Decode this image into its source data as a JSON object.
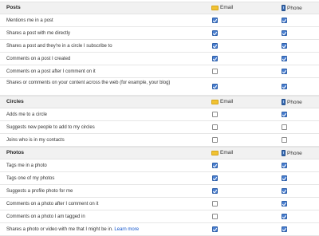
{
  "columns": {
    "email": "Email",
    "phone": "Phone"
  },
  "sections": [
    {
      "title": "Posts",
      "rows": [
        {
          "label": "Mentions me in a post",
          "email": true,
          "phone": true
        },
        {
          "label": "Shares a post with me directly",
          "email": true,
          "phone": true
        },
        {
          "label": "Shares a post and they're in a circle I subscribe to",
          "email": true,
          "phone": true
        },
        {
          "label": "Comments on a post I created",
          "email": true,
          "phone": true
        },
        {
          "label": "Comments on a post after I comment on it",
          "email": false,
          "phone": true
        },
        {
          "label": "Shares or comments on your content across the web (for example, your blog)",
          "email": true,
          "phone": true
        }
      ]
    },
    {
      "title": "Circles",
      "rows": [
        {
          "label": "Adds me to a circle",
          "email": false,
          "phone": true
        },
        {
          "label": "Suggests new people to add to my circles",
          "email": false,
          "phone": false
        },
        {
          "label": "Joins who is in my contacts",
          "email": false,
          "phone": false
        }
      ]
    },
    {
      "title": "Photos",
      "rows": [
        {
          "label": "Tags me in a photo",
          "email": true,
          "phone": true
        },
        {
          "label": "Tags one of my photos",
          "email": true,
          "phone": true
        },
        {
          "label": "Suggests a profile photo for me",
          "email": true,
          "phone": true
        },
        {
          "label": "Comments on a photo after I comment on it",
          "email": false,
          "phone": true
        },
        {
          "label": "Comments on a photo I am tagged in",
          "email": false,
          "phone": true
        },
        {
          "label": "Shares a photo or video with me that I might be in.",
          "link": "Learn more",
          "email": true,
          "phone": true
        }
      ]
    }
  ],
  "colors": {
    "checked": "#4a7fd0",
    "link": "#1155cc",
    "header_bg": "#f1f1f1"
  },
  "icons": {
    "email": "envelope-icon",
    "phone": "mobile-phone-icon"
  }
}
